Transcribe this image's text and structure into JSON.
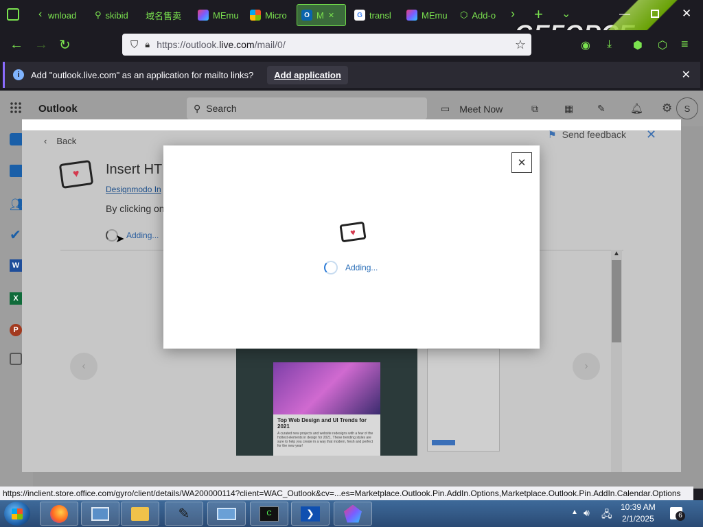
{
  "browser": {
    "tabs": [
      {
        "label": "wnload"
      },
      {
        "label": "skibid"
      },
      {
        "label": "域名售卖"
      },
      {
        "label": "MEmu"
      },
      {
        "label": "Micro"
      },
      {
        "label": "M"
      },
      {
        "label": "transl"
      },
      {
        "label": "MEmu"
      },
      {
        "label": "Add-o"
      }
    ],
    "url_prefix": "https://outlook.",
    "url_domain": "live.com",
    "url_path": "/mail/0/",
    "notification": {
      "text": "Add \"outlook.live.com\" as an application for mailto links?",
      "button": "Add application"
    },
    "overlay_logo": "GEFORCE"
  },
  "outlook": {
    "app_name": "Outlook",
    "search_placeholder": "Search",
    "meet_now": "Meet Now",
    "avatar_initial": "S"
  },
  "addin_panel": {
    "back_label": "Back",
    "send_feedback": "Send feedback",
    "title": "Insert HTI",
    "publisher": "Designmodo In",
    "consent_text": "By clicking on",
    "adding_label": "Adding...",
    "preview_heading": "Top Web Design and UI Trends for 2021",
    "preview_body": "A curated new projects and website redesigns with a few of the hottest elements in design for 2021. These trending styles are sure to help you create in a way that modern, fresh and perfect for the new year!"
  },
  "modal": {
    "adding_label": "Adding..."
  },
  "status_bar": {
    "url": "https://inclient.store.office.com/gyro/client/details/WA200000114?client=WAC_Outlook&cv=...es=Marketplace.Outlook.Pin.AddIn.Options,Marketplace.Outlook.Pin.AddIn.Calendar.Options"
  },
  "taskbar": {
    "time": "10:39 AM",
    "date": "2/1/2025",
    "notification_count": "6"
  }
}
